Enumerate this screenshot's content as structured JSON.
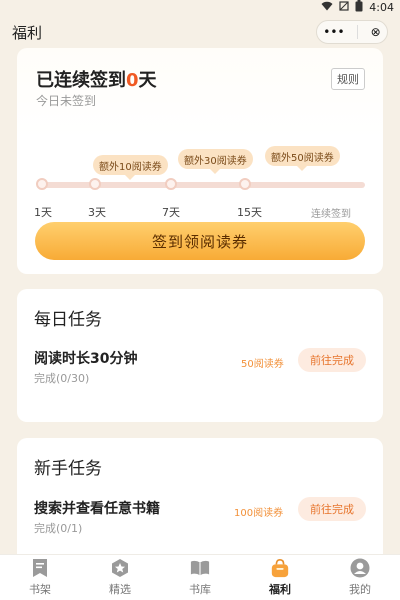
{
  "status": {
    "time": "4:04"
  },
  "header": {
    "title": "福利",
    "more_glyph": "•••",
    "close_glyph": "⊗"
  },
  "checkin": {
    "title_prefix": "已连续签到",
    "streak": "0",
    "title_suffix": "天",
    "subtitle": "今日未签到",
    "rules_label": "规则",
    "milestones": [
      {
        "day": "1天"
      },
      {
        "day": "3天",
        "reward": "额外10阅读券"
      },
      {
        "day": "7天",
        "reward": "额外30阅读券"
      },
      {
        "day": "15天",
        "reward": "额外50阅读券"
      }
    ],
    "streak_note": "连续签到",
    "button_label": "签到领阅读券"
  },
  "daily": {
    "title": "每日任务",
    "task": {
      "name": "阅读时长30分钟",
      "progress": "完成(0/30)",
      "reward": "50阅读券",
      "action": "前往完成"
    }
  },
  "newbie": {
    "title": "新手任务",
    "task": {
      "name": "搜索并查看任意书籍",
      "progress": "完成(0/1)",
      "reward": "100阅读券",
      "action": "前往完成"
    }
  },
  "tabs": [
    {
      "label": "书架",
      "icon": "bookshelf-icon"
    },
    {
      "label": "精选",
      "icon": "star-hexagon-icon"
    },
    {
      "label": "书库",
      "icon": "open-book-icon"
    },
    {
      "label": "福利",
      "icon": "gift-bag-icon",
      "active": true
    },
    {
      "label": "我的",
      "icon": "user-icon"
    }
  ],
  "colors": {
    "accent": "#f05a24",
    "button": "#f8ab36",
    "active_tab": "#f7a23b",
    "inactive_icon": "#9a9a9a"
  }
}
